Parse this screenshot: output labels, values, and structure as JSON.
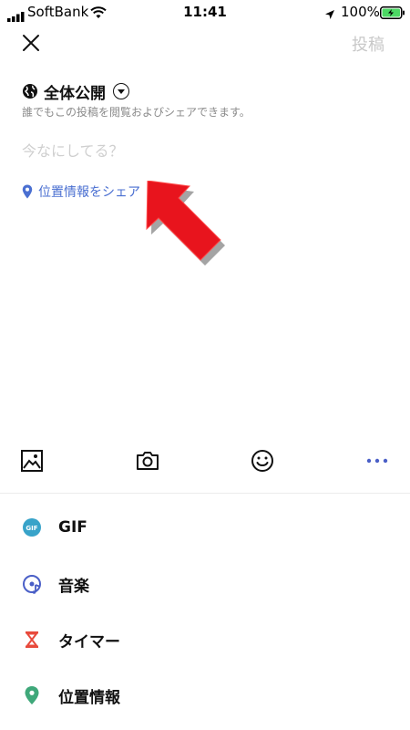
{
  "status_bar": {
    "carrier": "SoftBank",
    "time": "11:41",
    "battery": "100%"
  },
  "header": {
    "post_label": "投稿"
  },
  "privacy": {
    "label": "全体公開",
    "description": "誰でもこの投稿を閲覧およびシェアできます。"
  },
  "composer": {
    "placeholder": "今なにしてる？"
  },
  "location_share": {
    "label": "位置情報をシェア",
    "color": "#4a6fd1"
  },
  "toolbar": {
    "icons": [
      "image-icon",
      "camera-icon",
      "emoji-icon",
      "more-icon"
    ]
  },
  "menu": {
    "items": [
      {
        "label": "GIF",
        "icon": "gif-icon",
        "color": "#38a3c9"
      },
      {
        "label": "音楽",
        "icon": "music-icon",
        "color": "#4a5fc7"
      },
      {
        "label": "タイマー",
        "icon": "timer-icon",
        "color": "#e84a3c"
      },
      {
        "label": "位置情報",
        "icon": "location-icon",
        "color": "#3fa87a"
      }
    ]
  },
  "annotation": {
    "arrow_color": "#e8141d"
  }
}
